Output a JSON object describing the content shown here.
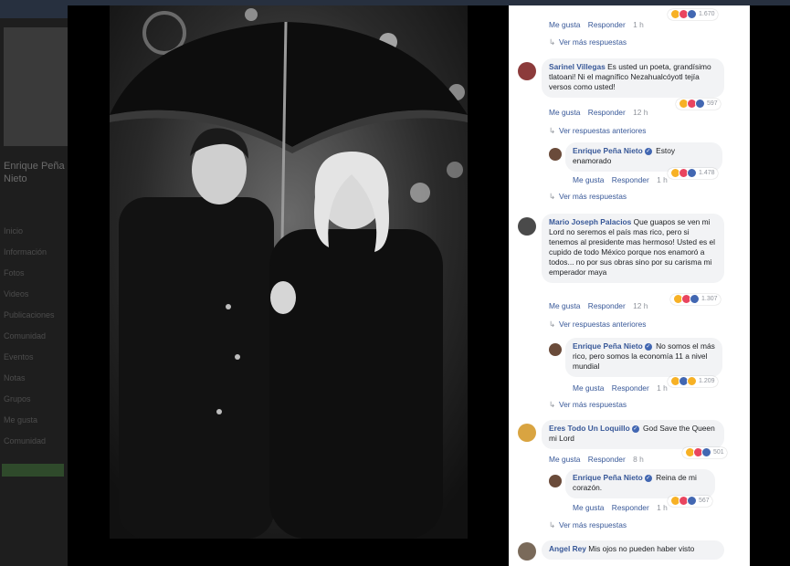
{
  "backdrop": {
    "page_title": "Enrique Peña Nieto",
    "nav_items": [
      "Inicio",
      "Información",
      "Fotos",
      "Videos",
      "Publicaciones",
      "Comunidad",
      "Eventos",
      "Notas",
      "Grupos",
      "Me gusta",
      "Comunidad",
      "Información"
    ]
  },
  "labels": {
    "like": "Me gusta",
    "reply": "Responder",
    "more_replies": "Ver más respuestas",
    "previous_replies": "Ver respuestas anteriores"
  },
  "top_partial": {
    "time": "1 h",
    "reactions": "1.670"
  },
  "comments": [
    {
      "author": "Sarinel Villegas",
      "text": " Es usted un poeta, grandísimo tlatoani! Ni el magnífico Nezahualcóyotl tejía versos como usted!",
      "time": "12 h",
      "reactions": "597",
      "after": "Ver respuestas anteriores"
    },
    {
      "author": "Enrique Peña Nieto",
      "text": " Estoy enamorado",
      "time": "1 h",
      "reactions": "1.478",
      "after": "Ver más respuestas"
    },
    {
      "author": "Mario Joseph Palacios",
      "text": " Que guapos se ven mi Lord no seremos el país mas rico, pero si tenemos al presidente mas hermoso! Usted es el cupido de todo México porque nos enamoró a todos... no por sus obras sino por su carisma mi emperador maya",
      "time": "12 h",
      "reactions": "1.307",
      "after": "Ver respuestas anteriores"
    },
    {
      "author": "Enrique Peña Nieto",
      "text": " No somos el más rico, pero somos la economía 11 a nivel mundial",
      "time": "1 h",
      "reactions": "1.209",
      "after": "Ver más respuestas"
    },
    {
      "author": "Eres Todo Un Loquillo",
      "text": " God Save the Queen mi Lord",
      "time": "8 h",
      "reactions": "501",
      "after": ""
    },
    {
      "author": "Enrique Peña Nieto",
      "text": " Reina de mi corazón.",
      "time": "1 h",
      "reactions": "567",
      "after": "Ver más respuestas"
    },
    {
      "author": "Angel Rey",
      "text": " Mis ojos no pueden haber visto",
      "time": "",
      "reactions": "",
      "after": ""
    }
  ]
}
